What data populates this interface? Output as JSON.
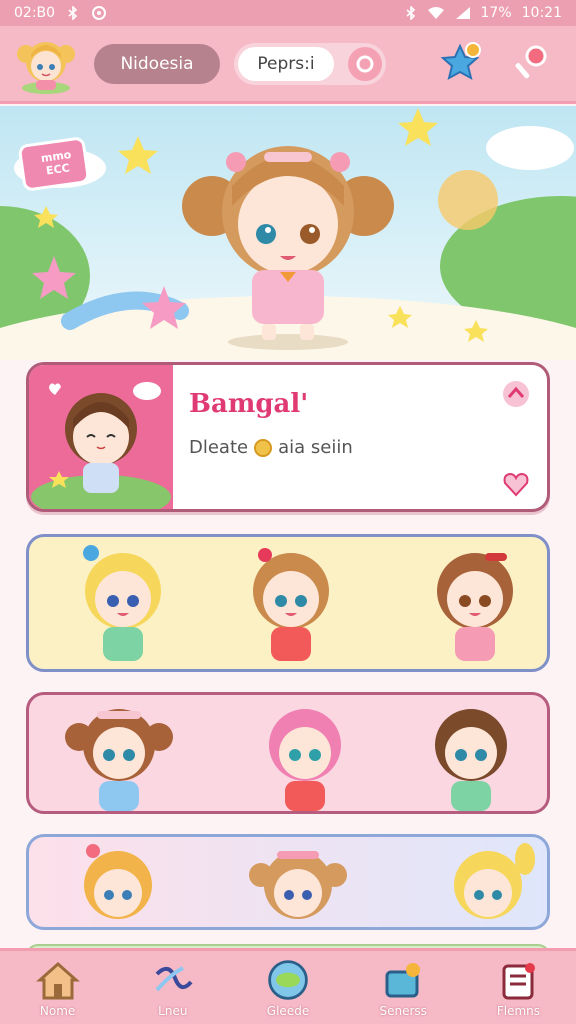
{
  "status_bar": {
    "time_left": "02:B0",
    "battery": "17%",
    "clock": "10:21"
  },
  "header": {
    "region_label": "Nidoesia",
    "search_label": "Peprs:i",
    "icons": [
      "avatar",
      "star-badge-icon",
      "candy-icon"
    ]
  },
  "hero": {
    "sticker_text": "mmo ECC"
  },
  "featured": {
    "title": "Bamgal'",
    "meta_text": "Dleate",
    "meta_suffix": "aia seiin"
  },
  "nav": {
    "items": [
      {
        "label": "Nome",
        "icon": "home-icon"
      },
      {
        "label": "Lneu",
        "icon": "ribbon-icon"
      },
      {
        "label": "Gleede",
        "icon": "bowl-icon"
      },
      {
        "label": "Senerss",
        "icon": "gift-icon"
      },
      {
        "label": "Flemns",
        "icon": "list-icon"
      }
    ]
  },
  "colors": {
    "accent": "#f6b9c6",
    "title_pink": "#e03a74",
    "status_bar": "#ec9fb0"
  }
}
